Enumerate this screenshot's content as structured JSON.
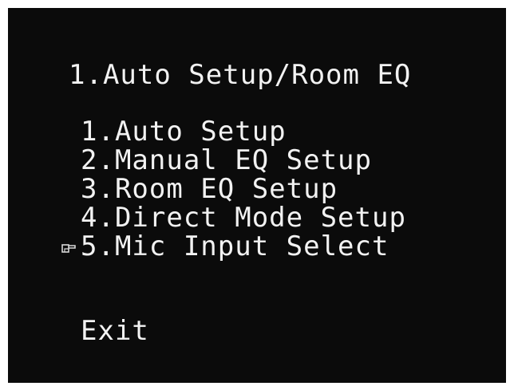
{
  "menu": {
    "title": "1.Auto Setup/Room EQ",
    "items": [
      {
        "label": "1.Auto Setup"
      },
      {
        "label": "2.Manual EQ Setup"
      },
      {
        "label": "3.Room EQ Setup"
      },
      {
        "label": "4.Direct Mode Setup"
      },
      {
        "label": "5.Mic Input Select",
        "selected": true
      }
    ],
    "exit_label": "Exit",
    "cursor_icon": "pointing-hand-icon"
  },
  "colors": {
    "background": "#0b0b0b",
    "text": "#f2f2f2"
  }
}
